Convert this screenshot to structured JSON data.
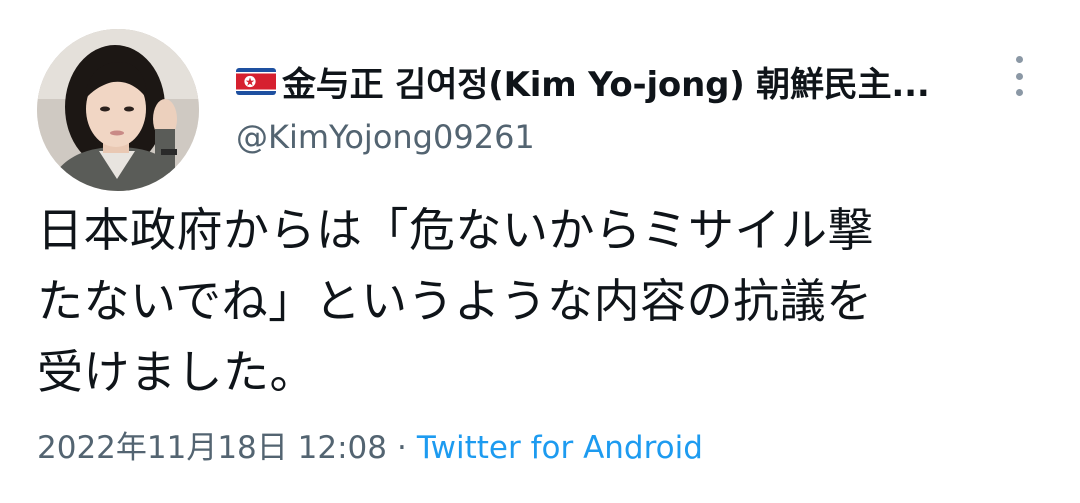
{
  "tweet": {
    "author": {
      "flag_icon": "north-korea-flag-icon",
      "display_name": "金与正 김여정(Kim Yo-jong) 朝鮮民主...",
      "handle": "@KimYojong09261"
    },
    "more_icon": "vertical-dots-icon",
    "text_lines": [
      "日本政府からは「危ないからミサイル撃",
      "たないでね」というような内容の抗議を",
      "受けました。"
    ],
    "timestamp": "2022年11月18日 12:08",
    "separator": "·",
    "source": "Twitter for Android",
    "colors": {
      "text": "#0f1419",
      "secondary": "#536471",
      "link": "#1d9bf0"
    }
  }
}
